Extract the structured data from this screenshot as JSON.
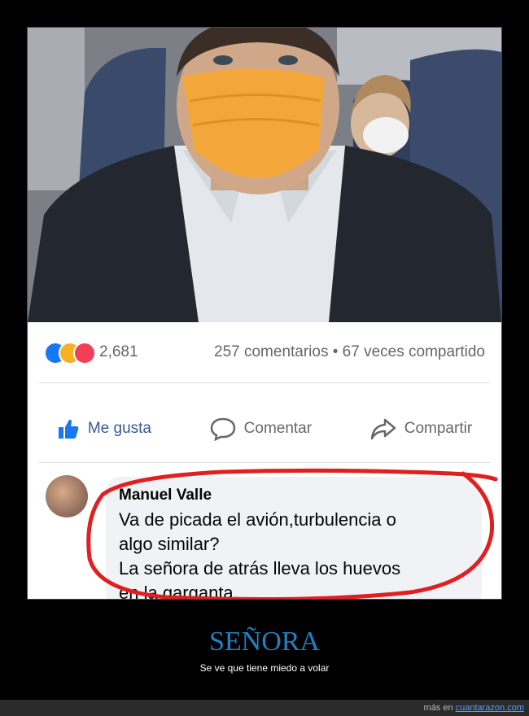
{
  "post": {
    "reactions": {
      "icons": [
        "like-icon",
        "haha-icon",
        "love-icon"
      ],
      "count": "2,681"
    },
    "comments_shares": "257 comentarios • 67 veces compartido",
    "actions": {
      "like": "Me gusta",
      "comment": "Comentar",
      "share": "Compartir"
    }
  },
  "comment": {
    "author": "Manuel Valle",
    "line1": "Va de picada el avión,turbulencia o",
    "line2": "algo similar?",
    "line3": "La señora de atrás lleva los huevos",
    "line4": "en la garganta."
  },
  "caption": {
    "title": "SEÑORA",
    "subtitle": "Se ve que tiene miedo a volar"
  },
  "footer": {
    "prefix": "más en",
    "site": "cuantarazon.com"
  },
  "colors": {
    "accent": "#1e82c5",
    "fb_blue": "#385898",
    "mask": "#f3a73a",
    "highlight_circle": "#e02020"
  }
}
